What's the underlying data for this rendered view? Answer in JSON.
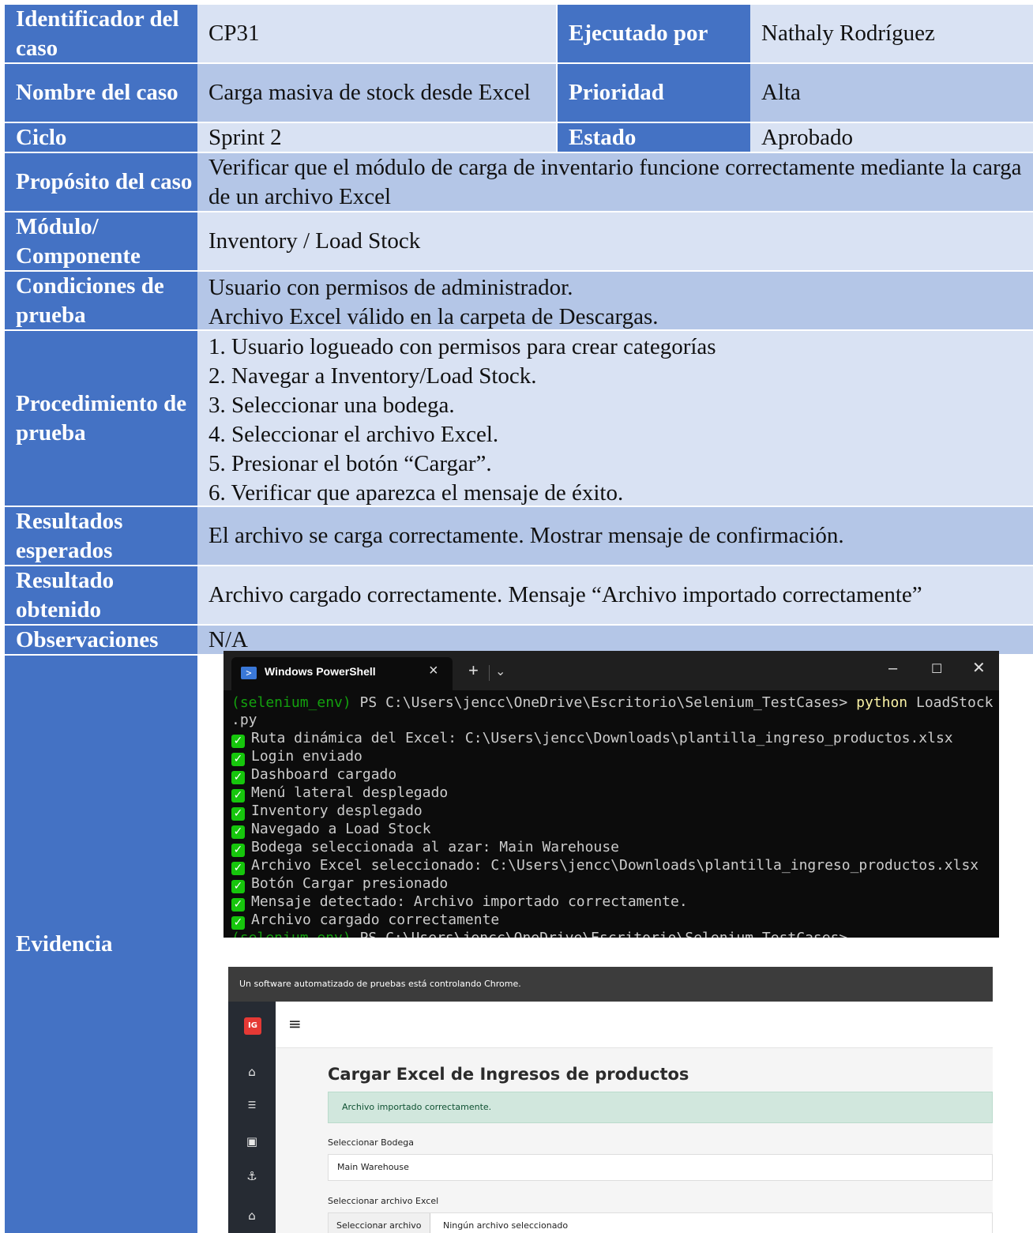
{
  "rows": {
    "identificador": {
      "label": "Identificador del caso",
      "value": "CP31",
      "label2": "Ejecutado por",
      "value2": "Nathaly Rodríguez"
    },
    "nombre": {
      "label": "Nombre del caso",
      "value": "Carga masiva de stock desde Excel",
      "label2": "Prioridad",
      "value2": "Alta"
    },
    "ciclo": {
      "label": "Ciclo",
      "value": "Sprint 2",
      "label2": "Estado",
      "value2": "Aprobado"
    },
    "proposito": {
      "label": "Propósito del caso",
      "value": "Verificar que el módulo de carga de inventario funcione correctamente mediante la carga de un archivo Excel"
    },
    "modulo": {
      "label": "Módulo/ Componente",
      "value": "Inventory / Load Stock"
    },
    "condiciones": {
      "label": "Condiciones de prueba",
      "lines": [
        "Usuario con permisos de administrador.",
        "Archivo Excel válido en la carpeta de Descargas."
      ]
    },
    "procedimiento": {
      "label": "Procedimiento de prueba",
      "steps": [
        "1. Usuario logueado con permisos para crear categorías",
        "2. Navegar a Inventory/Load Stock.",
        "3. Seleccionar una bodega.",
        "4. Seleccionar el archivo Excel.",
        "5. Presionar el botón “Cargar”.",
        "6. Verificar que aparezca el mensaje de éxito."
      ]
    },
    "esperados": {
      "label": "Resultados esperados",
      "value": "El archivo se carga correctamente. Mostrar mensaje de confirmación."
    },
    "obtenido": {
      "label": "Resultado obtenido",
      "value": "Archivo cargado correctamente. Mensaje “Archivo importado correctamente”"
    },
    "observaciones": {
      "label": "Observaciones",
      "value": "N/A"
    },
    "evidencia": {
      "label": "Evidencia"
    }
  },
  "powershell": {
    "tab_title": "Windows PowerShell",
    "prompt_env": "(selenium_env)",
    "prompt_path": " PS C:\\Users\\jencc\\OneDrive\\Escritorio\\Selenium_TestCases> ",
    "command": "python",
    "command_arg": " LoadStock",
    "command_wrap": ".py",
    "lines": [
      "Ruta dinámica del Excel: C:\\Users\\jencc\\Downloads\\plantilla_ingreso_productos.xlsx",
      "Login enviado",
      "Dashboard cargado",
      "Menú lateral desplegado",
      "Inventory desplegado",
      "Navegado a Load Stock",
      "Bodega seleccionada al azar: Main Warehouse",
      "Archivo Excel seleccionado: C:\\Users\\jencc\\Downloads\\plantilla_ingreso_productos.xlsx",
      "Botón Cargar presionado",
      "Mensaje detectado: Archivo importado correctamente.",
      "Archivo cargado correctamente"
    ],
    "last_prompt_env": "(selenium_env)",
    "last_prompt_path": " PS C:\\Users\\jencc\\OneDrive\\Escritorio\\Selenium_TestCases>"
  },
  "chrome": {
    "banner": "Un software automatizado de pruebas está controlando Chrome.",
    "logo": "IG",
    "heading": "Cargar Excel de Ingresos de productos",
    "alert": "Archivo importado correctamente.",
    "bodega_label": "Seleccionar Bodega",
    "bodega_value": "Main Warehouse",
    "archivo_label": "Seleccionar archivo Excel",
    "file_button": "Seleccionar archivo",
    "file_status": "Ningún archivo seleccionado"
  },
  "colors": {
    "header": "#4472c4",
    "row_light": "#d9e2f3",
    "row_mid": "#b4c6e7"
  }
}
